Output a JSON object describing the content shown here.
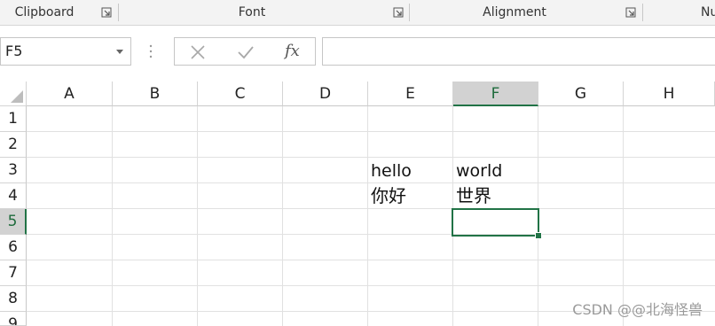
{
  "ribbon": {
    "groups": [
      {
        "label": "Clipboard"
      },
      {
        "label": "Font"
      },
      {
        "label": "Alignment"
      },
      {
        "label": "Nu"
      }
    ]
  },
  "formula_bar": {
    "name_box": "F5",
    "cancel_icon": "close-icon",
    "enter_icon": "check-icon",
    "function_label": "fx",
    "formula": ""
  },
  "sheet": {
    "columns": [
      "A",
      "B",
      "C",
      "D",
      "E",
      "F",
      "G",
      "H"
    ],
    "rows": [
      "1",
      "2",
      "3",
      "4",
      "5",
      "6",
      "7",
      "8",
      "9"
    ],
    "selected_column": "F",
    "selected_row": "5",
    "cells": {
      "E3": "hello",
      "F3": "world",
      "E4": "你好",
      "F4": "世界"
    },
    "accent_color": "#217346"
  },
  "watermark": "CSDN @@北海怪兽"
}
